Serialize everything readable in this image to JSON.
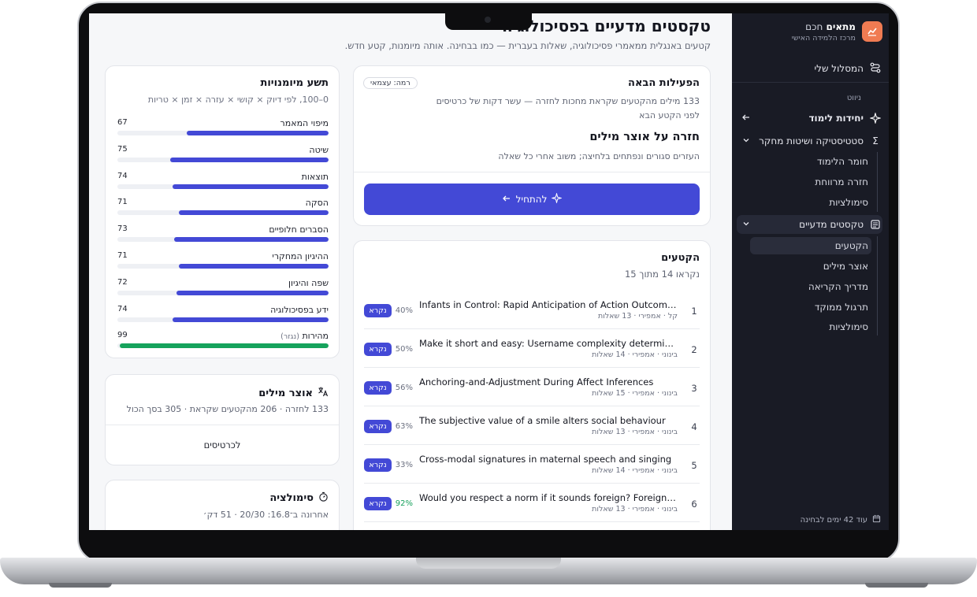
{
  "colors": {
    "accent": "#4349d6",
    "success": "#16a35c",
    "sidebar_bg": "#191b25",
    "brand": "#f07b52"
  },
  "sidebar": {
    "brand_name_strong": "מתאים",
    "brand_name_light": "חכם",
    "brand_sub": "מרכז הלמידה האישי",
    "my_path": "המסלול שלי",
    "nav_label": "ניווט",
    "units_label": "יחידות לימוד",
    "group1": {
      "label": "סטטיסטיקה ושיטות מחקר",
      "items": [
        "חומר הלימוד",
        "חזרה מרווחת",
        "סימולציות"
      ]
    },
    "group2": {
      "label": "טקסטים מדעיים",
      "items": [
        "הקטעים",
        "אוצר מילים",
        "מדריך הקריאה",
        "תרגול ממוקד",
        "סימולציות"
      ]
    },
    "exam_note": "עוד 42 ימים לבחינה"
  },
  "header": {
    "title": "טקסטים מדעיים בפסיכולוגיה",
    "subtitle": "קטעים באנגלית ממאמרי פסיכולוגיה, שאלות בעברית — כמו בבחינה. אותה מיומנות, קטע חדש."
  },
  "next": {
    "heading": "הפעילות הבאה",
    "level": "רמה: עצמאי",
    "desc": "133 מילים מהקטעים שקראת מחכות לחזרה — עשר דקות של כרטיסים לפני הקטע הבא",
    "title": "חזרה על אוצר מילים",
    "detail": "העזרים סגורים ונפתחים בלחיצה; משוב אחרי כל שאלה",
    "button": "להתחיל"
  },
  "passages": {
    "heading": "הקטעים",
    "count": "נקראו 14 מתוך 15",
    "read_label": "נקרא",
    "rows": [
      {
        "num": "1",
        "title": "Infants in Control: Rapid Anticipation of Action Outcomes in a Gaze-Contingent Paradigm",
        "meta": "קל · אמפירי · 13 שאלות",
        "pct": "40%",
        "pct_value": 40,
        "good": false
      },
      {
        "num": "2",
        "title": "Make it short and easy: Username complexity determines trustworthiness",
        "meta": "בינוני · אמפירי · 14 שאלות",
        "pct": "50%",
        "pct_value": 50,
        "good": false
      },
      {
        "num": "3",
        "title": "Anchoring-and-Adjustment During Affect Inferences",
        "meta": "בינוני · אמפירי · 15 שאלות",
        "pct": "56%",
        "pct_value": 56,
        "good": false
      },
      {
        "num": "4",
        "title": "The subjective value of a smile alters social behaviour",
        "meta": "בינוני · אמפירי · 13 שאלות",
        "pct": "63%",
        "pct_value": 63,
        "good": false
      },
      {
        "num": "5",
        "title": "Cross-modal signatures in maternal speech and singing",
        "meta": "בינוני · אמפירי · 14 שאלות",
        "pct": "33%",
        "pct_value": 33,
        "good": false
      },
      {
        "num": "6",
        "title": "Would you respect a norm if it sounds foreign? Foreign-accented speech",
        "meta": "בינוני · אמפירי · 13 שאלות",
        "pct": "92%",
        "pct_value": 92,
        "good": true
      }
    ]
  },
  "skills": {
    "heading": "תשע מיומנויות",
    "sub": "0–100, לפי דיוק × קושי × עזרה × זמן × טריות",
    "items": [
      {
        "name": "מיפוי המאמר",
        "tag": "",
        "value": "67",
        "pct": 67,
        "green": false
      },
      {
        "name": "שיטה",
        "tag": "",
        "value": "75",
        "pct": 75,
        "green": false
      },
      {
        "name": "תוצאות",
        "tag": "",
        "value": "74",
        "pct": 74,
        "green": false
      },
      {
        "name": "הסקה",
        "tag": "",
        "value": "71",
        "pct": 71,
        "green": false
      },
      {
        "name": "הסברים חלופיים",
        "tag": "",
        "value": "73",
        "pct": 73,
        "green": false
      },
      {
        "name": "ההיגיון המחקרי",
        "tag": "",
        "value": "71",
        "pct": 71,
        "green": false
      },
      {
        "name": "שפה והיגיון",
        "tag": "",
        "value": "72",
        "pct": 72,
        "green": false
      },
      {
        "name": "ידע בפסיכולוגיה",
        "tag": "",
        "value": "74",
        "pct": 74,
        "green": false
      },
      {
        "name": "מהירות",
        "tag": "(נגזר)",
        "value": "99",
        "pct": 99,
        "green": true
      }
    ]
  },
  "vocab": {
    "heading": "אוצר מילים",
    "sub": "133 לחזרה · 206 מהקטעים שקראת · 305 בסך הכול",
    "link": "לכרטיסים"
  },
  "sim": {
    "heading": "סימולציה",
    "sub": "אחרונה ב־16.8: 20/30 · 51 דק׳"
  }
}
